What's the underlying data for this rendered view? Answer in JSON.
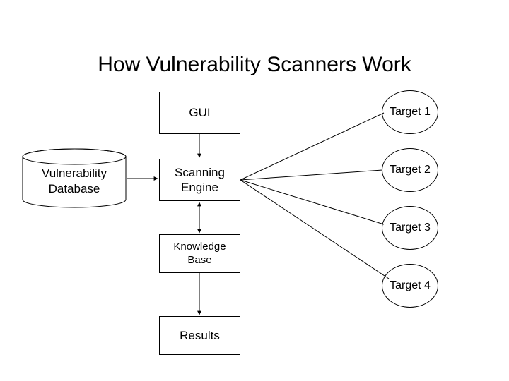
{
  "title": "How Vulnerability Scanners Work",
  "nodes": {
    "gui": "GUI",
    "vuln_db": "Vulnerability\nDatabase",
    "scan_engine": "Scanning\nEngine",
    "knowledge_base": "Knowledge\nBase",
    "results": "Results",
    "target1": "Target 1",
    "target2": "Target 2",
    "target3": "Target 3",
    "target4": "Target 4"
  }
}
